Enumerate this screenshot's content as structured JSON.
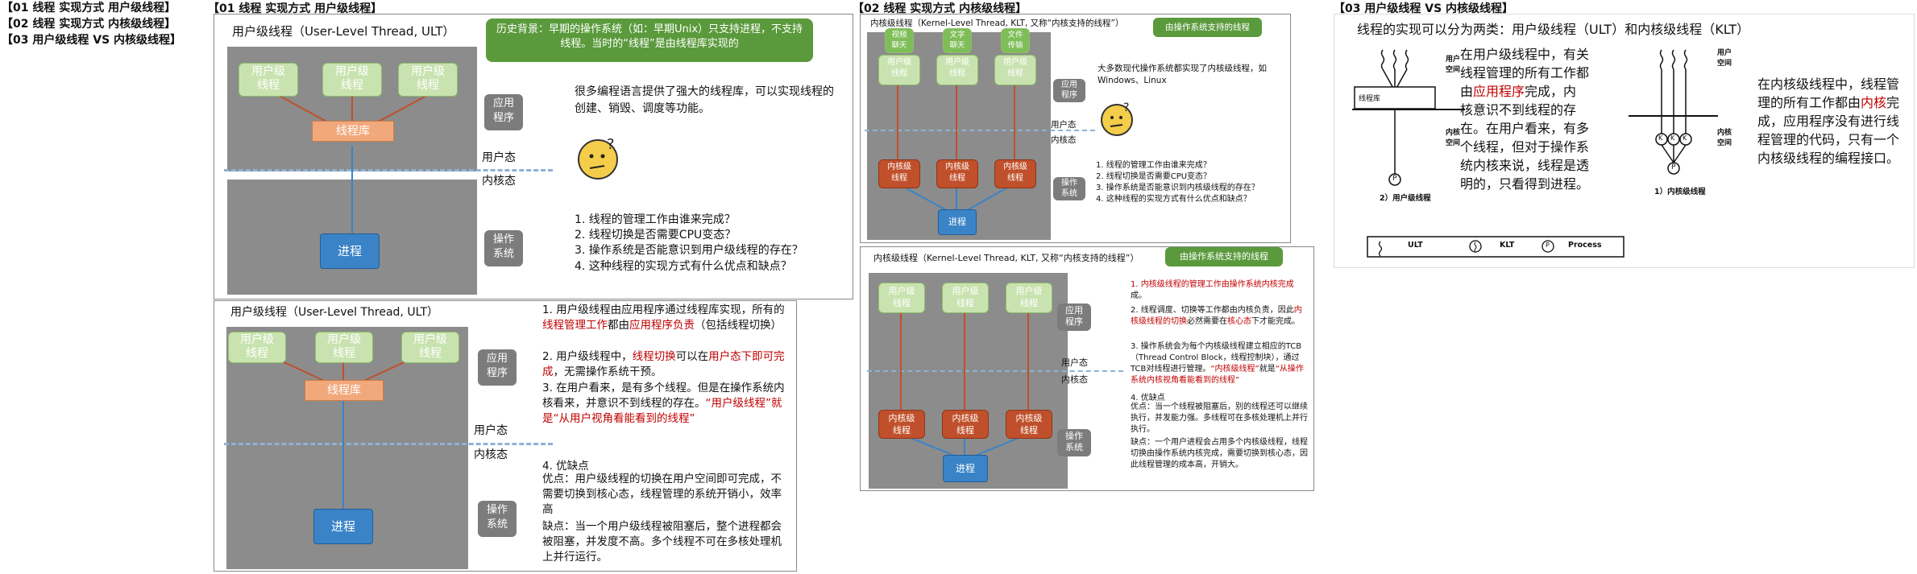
{
  "toc": [
    "【01 线程 实现方式 用户级线程】",
    "【02 线程 实现方式 内核级线程】",
    "【03 用户级线程 VS 内核级线程】"
  ],
  "headers": {
    "s1": "【01 线程 实现方式 用户级线程】",
    "s2": "【02 线程 实现方式 内核级线程】",
    "s3": "【03 用户级线程 VS 内核级线程】"
  },
  "panel1": {
    "title": "用户级线程（User-Level Thread, ULT）",
    "callout": "历史背景：早期的操作系统（如：早期Unix）只支持进程，不支持线程。当时的“线程”是由线程库实现的",
    "threads": [
      "用户级\n线程",
      "用户级\n线程",
      "用户级\n线程"
    ],
    "library": "线程库",
    "process": "进程",
    "tag_app": "应用\n程序",
    "tag_os": "操作\n系统",
    "user_mode": "用户态",
    "kernel_mode": "内核态",
    "intro": "很多编程语言提供了强大的线程库，可以实现线程的创建、销毁、调度等功能。",
    "questions": [
      "1.  线程的管理工作由谁来完成？",
      "2.  线程切换是否需要CPU变态？",
      "3.  操作系统是否能意识到用户级线程的存在？",
      "4.  这种线程的实现方式有什么优点和缺点？"
    ]
  },
  "panel2": {
    "title": "用户级线程（User-Level Thread, ULT）",
    "threads": [
      "用户级\n线程",
      "用户级\n线程",
      "用户级\n线程"
    ],
    "library": "线程库",
    "process": "进程",
    "tag_app": "应用\n程序",
    "tag_os": "操作\n系统",
    "user_mode": "用户态",
    "kernel_mode": "内核态",
    "p1_a": "1. 用户级线程由应用程序通过线程库实现，所有的",
    "p1_r1": "线程管理工作",
    "p1_b": "都由",
    "p1_r2": "应用程序负责",
    "p1_c": "（包括线程切换）",
    "p2_a": "2. 用户级线程中，",
    "p2_r1": "线程切换",
    "p2_b": "可以在",
    "p2_r2": "用户态下即可完成",
    "p2_c": "，无需操作系统干预。",
    "p3": "3. 在用户看来，是有多个线程。但是在操作系统内核看来，并意识不到线程的存在。",
    "p3_r": "“用户级线程”就是“从用户视角看能看到的线程”",
    "p4_title": "4. 优缺点",
    "p4_pro": "优点：用户级线程的切换在用户空间即可完成，不需要切换到核心态，线程管理的系统开销小，效率高",
    "p4_con": "缺点：当一个用户级线程被阻塞后，整个进程都会被阻塞，并发度不高。多个线程不可在多核处理机上并行运行。"
  },
  "panel3": {
    "title": "内核级线程（Kernel-Level Thread, KLT, 又称“内核支持的线程”）",
    "callout": "由操作系统支持的线程",
    "top_threads": [
      "视频\n聊天",
      "文字\n聊天",
      "文件\n传输"
    ],
    "u_threads": [
      "用户级\n线程",
      "用户级\n线程",
      "用户级\n线程"
    ],
    "k_threads": [
      "内核级\n线程",
      "内核级\n线程",
      "内核级\n线程"
    ],
    "process": "进程",
    "tag_app": "应用\n程序",
    "tag_os": "操作\n系统",
    "user_mode": "用户态",
    "kernel_mode": "内核态",
    "intro": "大多数现代操作系统都实现了内核级线程，如Windows、Linux",
    "questions": [
      "1.  线程的管理工作由谁来完成？",
      "2.  线程切换是否需要CPU变态？",
      "3.  操作系统是否能意识到内核级线程的存在？",
      "4.  这种线程的实现方式有什么优点和缺点？"
    ]
  },
  "panel4": {
    "title": "内核级线程（Kernel-Level Thread, KLT, 又称“内核支持的线程”）",
    "callout": "由操作系统支持的线程",
    "u_threads": [
      "用户级\n线程",
      "用户级\n线程",
      "用户级\n线程"
    ],
    "k_threads": [
      "内核级\n线程",
      "内核级\n线程",
      "内核级\n线程"
    ],
    "process": "进程",
    "tag_app": "应用\n程序",
    "tag_os": "操作\n系统",
    "user_mode": "用户态",
    "kernel_mode": "内核态",
    "p1": "1. 内核级线程的管理工作由操作系统内核完成",
    "p1_end": "成。",
    "p2_a": "2. 线程调度、切换等工作都由内核负责，因此",
    "p2_r1": "内核级线程的切换",
    "p2_b": "必然需要在",
    "p2_r2": "核心态",
    "p2_c": "下才能完成。",
    "p3_a": "3. 操作系统会为每个内核级线程建立相应的TCB（Thread Control Block，线程控制块），通过TCB对线程进行管理。",
    "p3_r1": "“内核级线程”",
    "p3_b": "就是",
    "p3_r2": "“从操作系统内核视角看能看到的线程”",
    "p4_title": "4. 优缺点",
    "p4_pro": "优点：当一个线程被阻塞后，别的线程还可以继续执行，并发能力强。多线程可在多核处理机上并行执行。",
    "p4_con": "缺点：一个用户进程会占用多个内核级线程，线程切换由操作系统内核完成，需要切换到核心态，因此线程管理的成本高，开销大。"
  },
  "panel5": {
    "heading": "线程的实现可以分为两类：用户级线程（ULT）和内核级线程（KLT）",
    "ult_text_a": "在用户级线程中，有关线程管理的所有工作都由",
    "ult_text_r": "应用程序",
    "ult_text_b": "完成，内核意识不到线程的存在。在用户看来，有多个线程，但对于操作系统内核来说，线程是透明的，只看得到进程。",
    "klt_text_a": "在内核级线程中，线程管理的所有工作都由",
    "klt_text_r": "内核",
    "klt_text_b": "完成，应用程序没有进行线程管理的代码，只有一个内核级线程的编程接口。",
    "ult_caption": "2）用户级线程",
    "klt_caption": "1）内核级线程",
    "lib_label": "线程库",
    "user_space": "用户\n空间",
    "kernel_space": "内核\n空间",
    "p_label": "P",
    "k_label": "K",
    "legend": [
      "ULT",
      "KLT",
      "Process"
    ]
  }
}
